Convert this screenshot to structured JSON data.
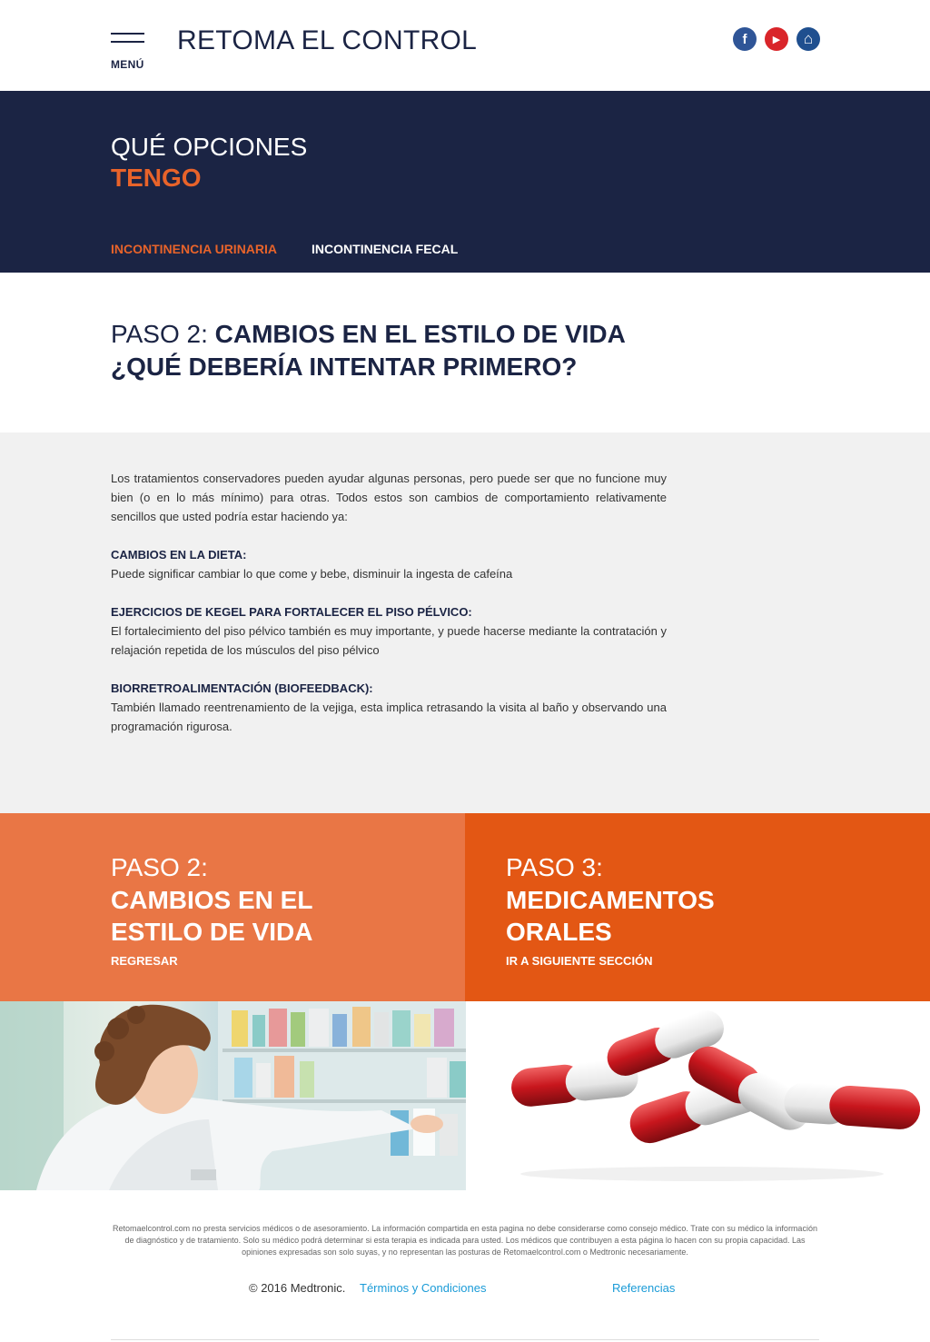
{
  "header": {
    "menu_label": "MENÚ",
    "site_title": "RETOMA EL CONTROL",
    "social": [
      {
        "name": "facebook",
        "glyph": "f"
      },
      {
        "name": "youtube",
        "glyph": "▶"
      },
      {
        "name": "home",
        "glyph": "⌂"
      }
    ]
  },
  "hero": {
    "line1": "QUÉ OPCIONES",
    "line2": "TENGO",
    "tabs": [
      "INCONTINENCIA URINARIA",
      "INCONTINENCIA FECAL"
    ]
  },
  "step_heading": {
    "prefix": "PASO 2: ",
    "title": "CAMBIOS EN EL ESTILO DE VIDA",
    "subtitle": "¿QUÉ DEBERÍA INTENTAR PRIMERO?"
  },
  "content": {
    "intro": "Los tratamientos conservadores pueden ayudar algunas personas, pero puede ser que no funcione muy bien (o en lo más mínimo) para otras. Todos estos son cambios de comportamiento relativamente sencillos que usted podría estar haciendo ya:",
    "sections": [
      {
        "heading": "CAMBIOS EN LA DIETA:",
        "text": "Puede significar cambiar lo que come y bebe, disminuir la ingesta de cafeína"
      },
      {
        "heading": "EJERCICIOS DE KEGEL PARA FORTALECER EL PISO PÉLVICO:",
        "text": "El fortalecimiento del piso pélvico también es muy importante, y puede hacerse mediante la contratación y relajación repetida de los músculos del piso pélvico"
      },
      {
        "heading": "BIORRETROALIMENTACIÓN (BIOFEEDBACK):",
        "text": "También llamado reentrenamiento de la vejiga, esta implica retrasando la visita al baño y observando una programación rigurosa."
      }
    ]
  },
  "steps": {
    "prev": {
      "label": "PASO 2:",
      "title_line1": "CAMBIOS EN EL",
      "title_line2": "ESTILO DE VIDA",
      "link": "REGRESAR"
    },
    "next": {
      "label": "PASO 3:",
      "title_line1": "MEDICAMENTOS",
      "title_line2": "ORALES",
      "link": "IR A SIGUIENTE SECCIÓN"
    }
  },
  "footer": {
    "disclaimer": "Retomaelcontrol.com no presta servicios médicos o de asesoramiento. La información compartida en esta pagina no debe considerarse como consejo médico. Trate con su médico la información de diagnóstico y de tratamiento. Solo su médico podrá determinar si esta terapia es indicada para usted. Los médicos que contribuyen a esta página lo hacen con su propia capacidad. Las opiniones expresadas son solo suyas, y no representan las posturas de Retomaelcontrol.com o Medtronic necesariamente.",
    "copyright": "© 2016 Medtronic.",
    "terms": "Términos y Condiciones",
    "references": "Referencias"
  },
  "colors": {
    "navy": "#1b2444",
    "orange": "#e8632a",
    "orange_light": "#e97645",
    "orange_dark": "#e35714",
    "link_blue": "#1a9bd7"
  }
}
